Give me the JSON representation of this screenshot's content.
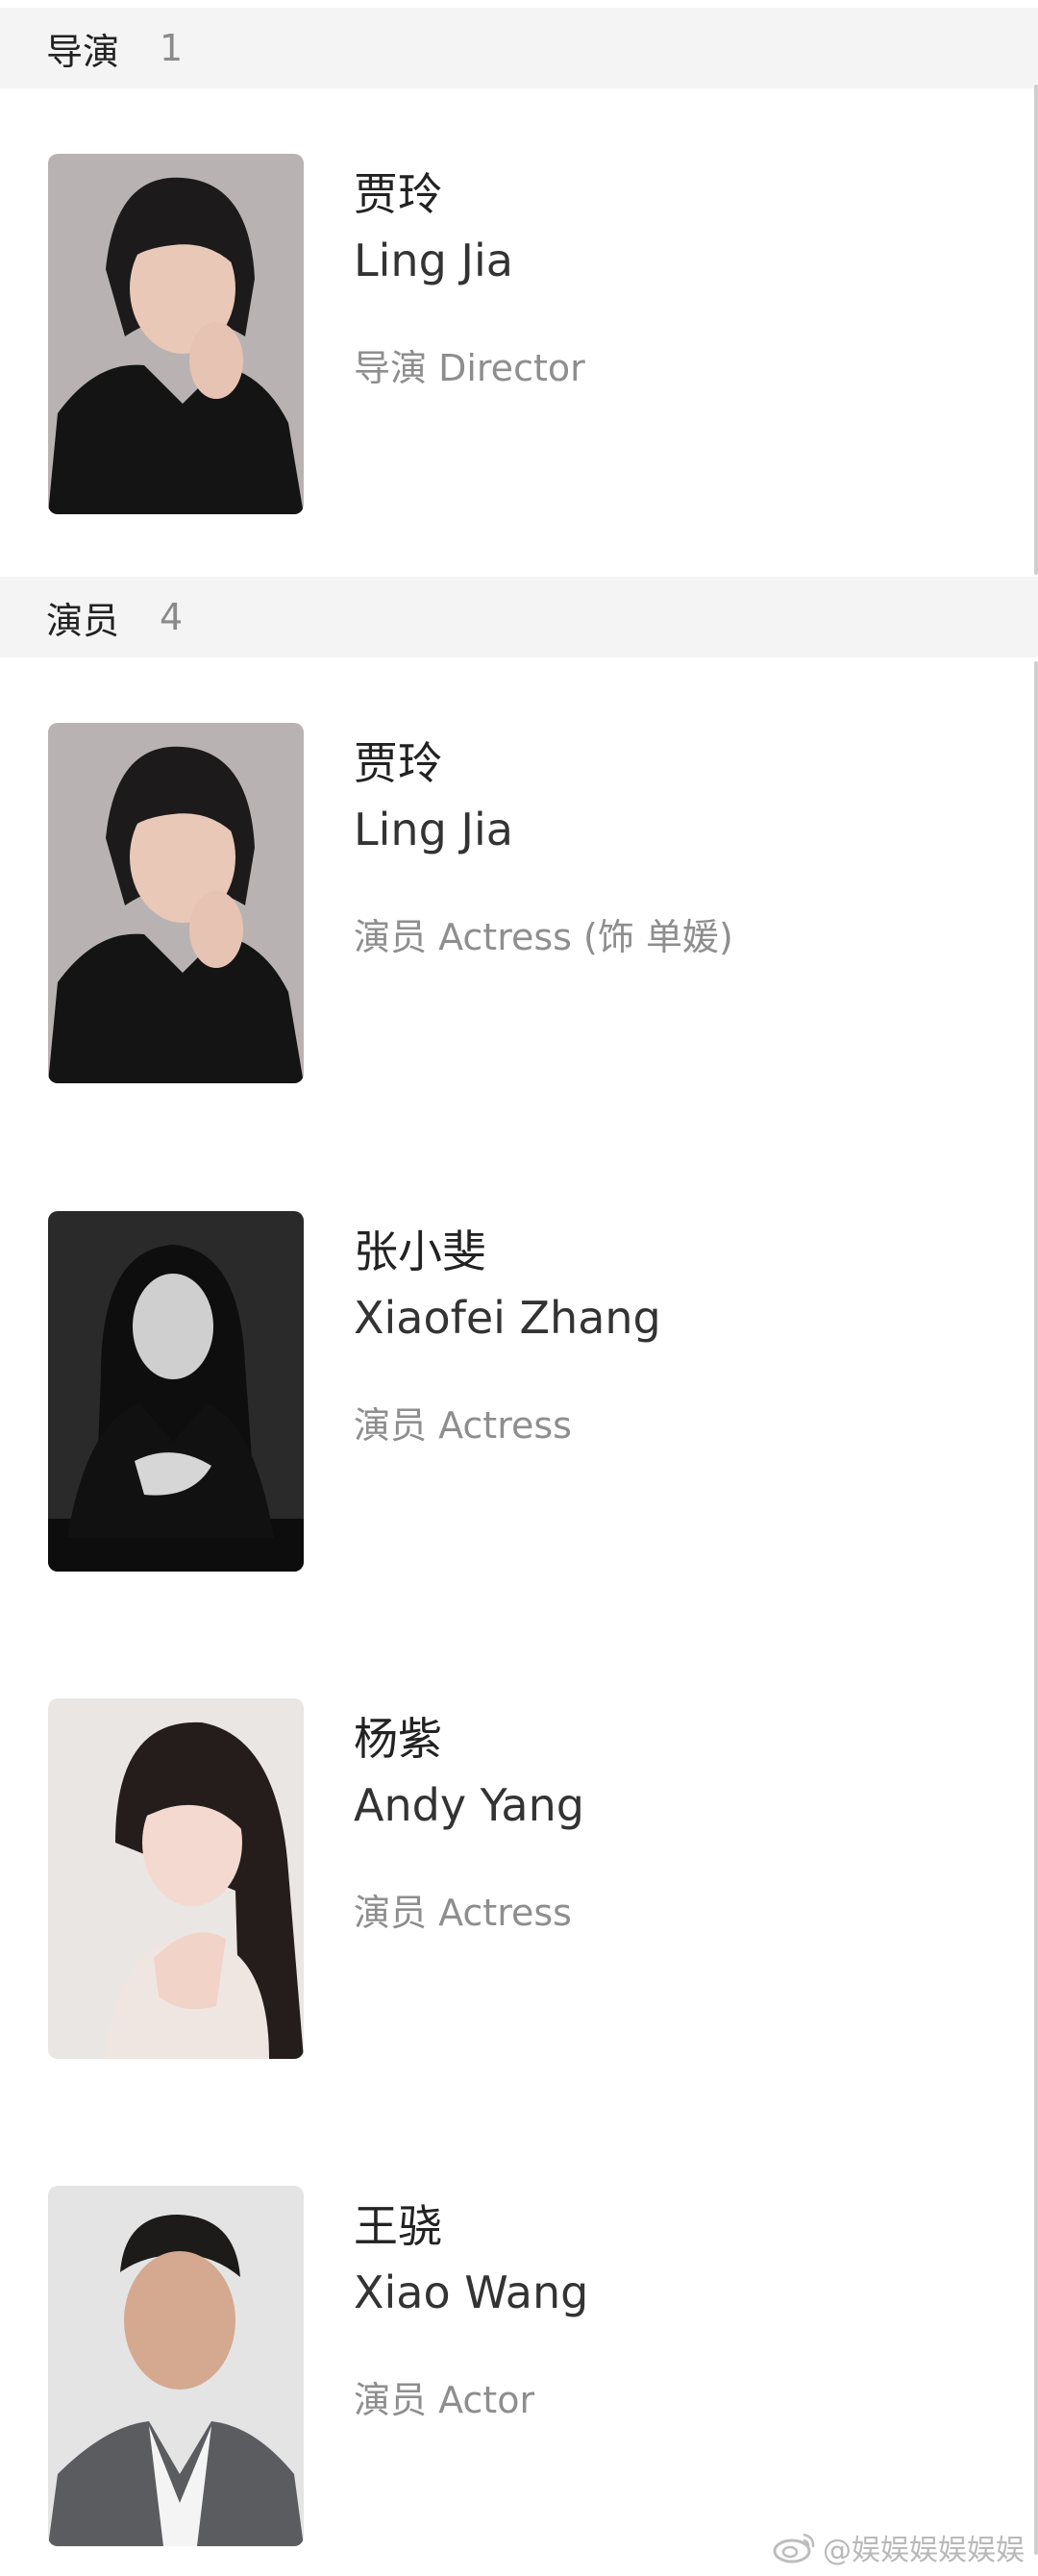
{
  "directors_section": {
    "title": "导演",
    "count": "1"
  },
  "directors": [
    {
      "name_cn": "贾玲",
      "name_en": "Ling Jia",
      "role": "导演 Director"
    }
  ],
  "cast_section": {
    "title": "演员",
    "count": "4"
  },
  "cast": [
    {
      "name_cn": "贾玲",
      "name_en": "Ling Jia",
      "role": "演员 Actress (饰 单媛)"
    },
    {
      "name_cn": "张小斐",
      "name_en": "Xiaofei Zhang",
      "role": "演员 Actress"
    },
    {
      "name_cn": "杨紫",
      "name_en": "Andy Yang",
      "role": "演员 Actress"
    },
    {
      "name_cn": "王骁",
      "name_en": "Xiao Wang",
      "role": "演员 Actor"
    }
  ],
  "watermark": {
    "text": "@娱娱娱娱娱娱",
    "icon": "weibo-icon"
  }
}
